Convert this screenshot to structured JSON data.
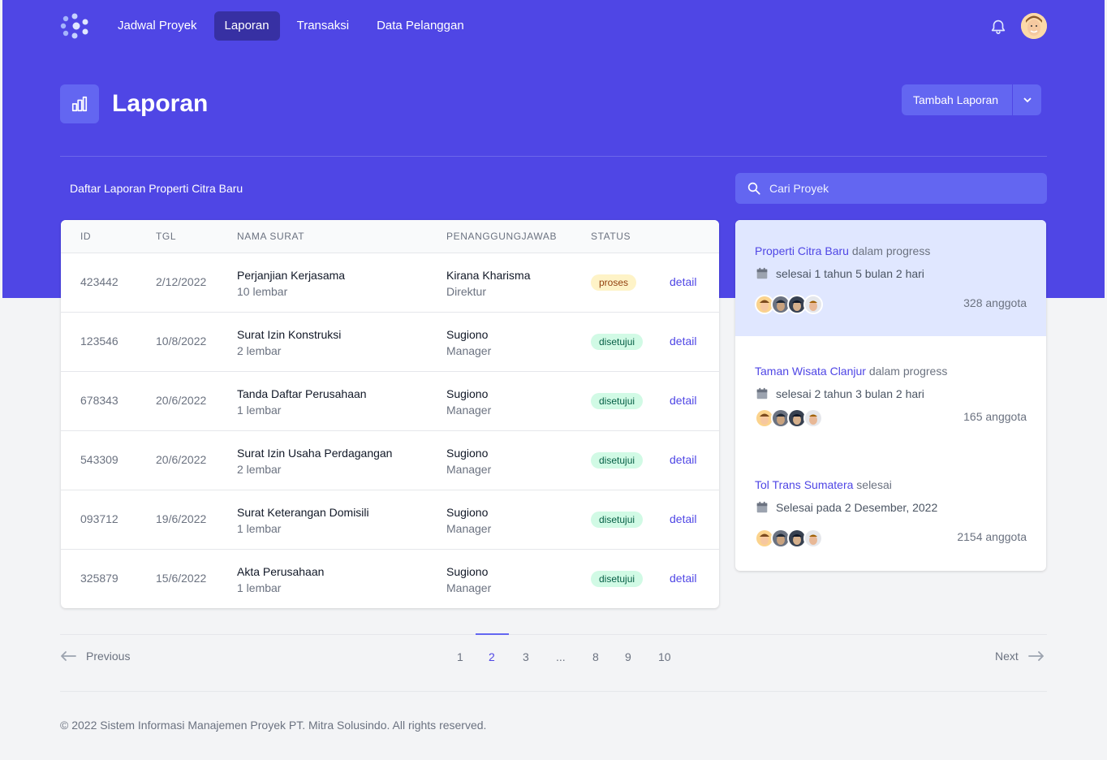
{
  "nav": {
    "items": [
      {
        "label": "Jadwal Proyek",
        "active": false
      },
      {
        "label": "Laporan",
        "active": true
      },
      {
        "label": "Transaksi",
        "active": false
      },
      {
        "label": "Data Pelanggan",
        "active": false
      }
    ]
  },
  "header": {
    "title": "Laporan",
    "add_button": "Tambah Laporan"
  },
  "list": {
    "subtitle": "Daftar Laporan Properti Citra Baru",
    "search_placeholder": "Cari Proyek"
  },
  "table": {
    "columns": [
      "ID",
      "TGL",
      "NAMA SURAT",
      "PENANGGUNGJAWAB",
      "STATUS"
    ],
    "rows": [
      {
        "id": "423442",
        "date": "2/12/2022",
        "name": "Perjanjian Kerjasama",
        "pages": "10 lembar",
        "resp": "Kirana Kharisma",
        "role": "Direktur",
        "status": "proses",
        "action": "detail"
      },
      {
        "id": "123546",
        "date": "10/8/2022",
        "name": "Surat Izin Konstruksi",
        "pages": "2 lembar",
        "resp": "Sugiono",
        "role": "Manager",
        "status": "disetujui",
        "action": "detail"
      },
      {
        "id": "678343",
        "date": "20/6/2022",
        "name": "Tanda Daftar Perusahaan",
        "pages": "1 lembar",
        "resp": "Sugiono",
        "role": "Manager",
        "status": "disetujui",
        "action": "detail"
      },
      {
        "id": "543309",
        "date": "20/6/2022",
        "name": "Surat Izin Usaha Perdagangan",
        "pages": "2 lembar",
        "resp": "Sugiono",
        "role": "Manager",
        "status": "disetujui",
        "action": "detail"
      },
      {
        "id": "093712",
        "date": "19/6/2022",
        "name": "Surat Keterangan Domisili",
        "pages": "1 lembar",
        "resp": "Sugiono",
        "role": "Manager",
        "status": "disetujui",
        "action": "detail"
      },
      {
        "id": "325879",
        "date": "15/6/2022",
        "name": "Akta Perusahaan",
        "pages": "1 lembar",
        "resp": "Sugiono",
        "role": "Manager",
        "status": "disetujui",
        "action": "detail"
      }
    ]
  },
  "projects": [
    {
      "name": "Properti Citra Baru",
      "state": "dalam progress",
      "timing": "selesai 1 tahun 5 bulan 2 hari",
      "members": "328 anggota",
      "highlighted": true
    },
    {
      "name": "Taman Wisata Clanjur",
      "state": "dalam progress",
      "timing": "selesai 2 tahun 3 bulan 2 hari",
      "members": "165 anggota",
      "highlighted": false
    },
    {
      "name": "Tol Trans Sumatera",
      "state": "selesai",
      "timing": "Selesai pada 2 Desember, 2022",
      "members": "2154 anggota",
      "highlighted": false
    }
  ],
  "pagination": {
    "prev": "Previous",
    "next": "Next",
    "pages": [
      "1",
      "2",
      "3",
      "...",
      "8",
      "9",
      "10"
    ],
    "current": "2"
  },
  "footer": {
    "text": "© 2022 Sistem Informasi Manajemen Proyek PT. Mitra Solusindo. All rights reserved."
  },
  "colors": {
    "brand": "#4f46e5",
    "brand_dark": "#3730a3",
    "proses_badge": "#fef3c7",
    "disetujui_badge": "#d1fae5"
  }
}
